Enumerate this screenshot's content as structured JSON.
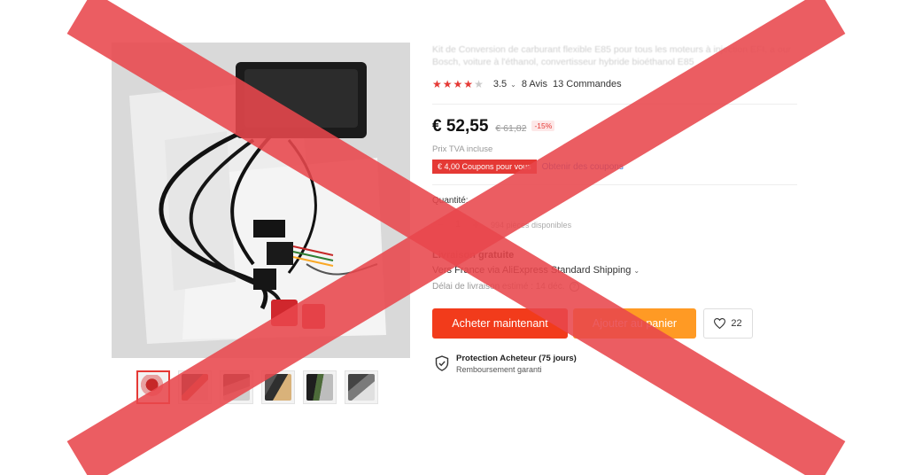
{
  "product": {
    "title": "Kit de Conversion de carburant flexible E85 pour tous les moteurs à injection EFI, a our Bosch, voiture à l'éthanol, convertisseur hybride bioéthanol E85",
    "rating": {
      "stars_filled": 4,
      "stars_total": 5,
      "score": "3.5",
      "reviews": "8 Avis",
      "orders": "13 Commandes"
    },
    "price": "€ 52,55",
    "old_price": "€ 61,82",
    "discount": "-15%",
    "tax_note": "Prix TVA incluse",
    "coupon_badge": "€ 4,00 Coupons pour vous",
    "coupon_link": "Obtenir des coupons"
  },
  "quantity": {
    "label": "Quantité:",
    "minus": "−",
    "value": "1",
    "plus": "+",
    "available": "994 pièces disponibles"
  },
  "shipping": {
    "title": "Livraison gratuite",
    "method": "Vers France via AliExpress Standard Shipping",
    "method_caret": "⌄",
    "delay": "Délai de livraison estimé : 14 déc.",
    "help_icon": "?"
  },
  "actions": {
    "buy_now": "Acheter maintenant",
    "add_to_cart": "Ajouter au panier",
    "wishlist_count": "22"
  },
  "protection": {
    "title": "Protection Acheteur (75 jours)",
    "subtitle": "Remboursement garanti"
  },
  "gallery": {
    "thumbnail_count": 6,
    "active_index": 0
  },
  "colors": {
    "accent_red": "#e53935",
    "buy_button": "#f23b1b",
    "cart_button": "#ff9a24",
    "overlay_cross": "#e8474c"
  },
  "icons": {
    "rating_caret": "⌄",
    "wishlist": "heart-icon",
    "protection": "shield-check-icon"
  }
}
